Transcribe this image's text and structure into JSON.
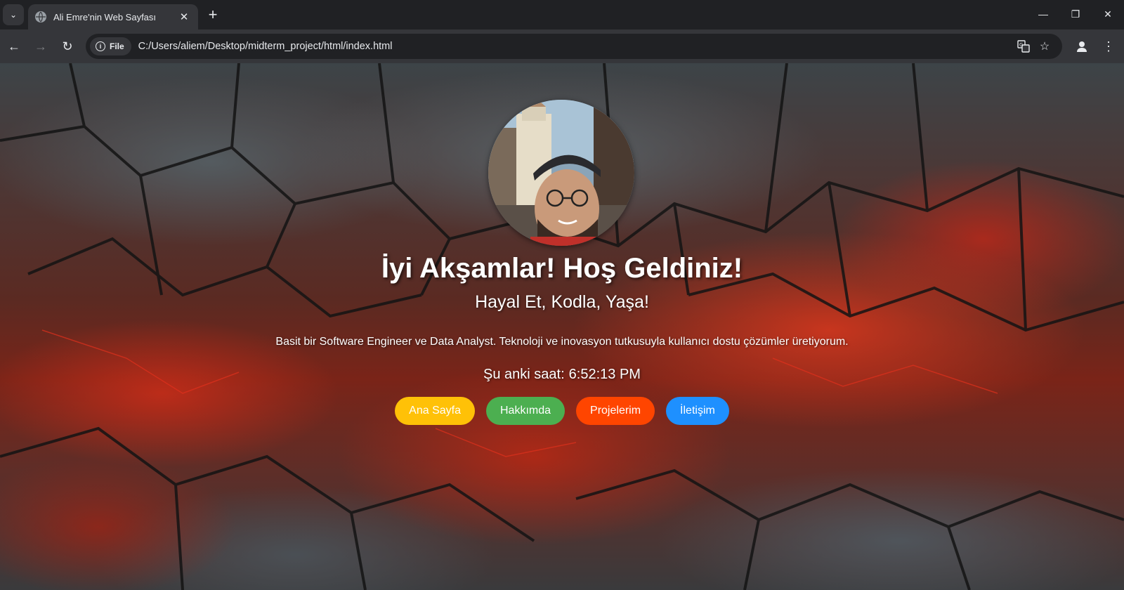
{
  "browser": {
    "tab_title": "Ali Emre'nin Web Sayfası",
    "site_chip": "File",
    "url": "C:/Users/aliem/Desktop/midterm_project/html/index.html"
  },
  "page": {
    "greeting": "İyi Akşamlar! Hoş Geldiniz!",
    "tagline": "Hayal Et, Kodla, Yaşa!",
    "bio": "Basit bir Software Engineer ve Data Analyst. Teknoloji ve inovasyon tutkusuyla kullanıcı dostu çözümler üretiyorum.",
    "clock_label": "Şu anki saat:",
    "clock_value": "6:52:13 PM",
    "buttons": [
      {
        "label": "Ana Sayfa",
        "color": "#ffc107"
      },
      {
        "label": "Hakkımda",
        "color": "#4caf50"
      },
      {
        "label": "Projelerim",
        "color": "#ff4500"
      },
      {
        "label": "İletişim",
        "color": "#1e90ff"
      }
    ]
  }
}
